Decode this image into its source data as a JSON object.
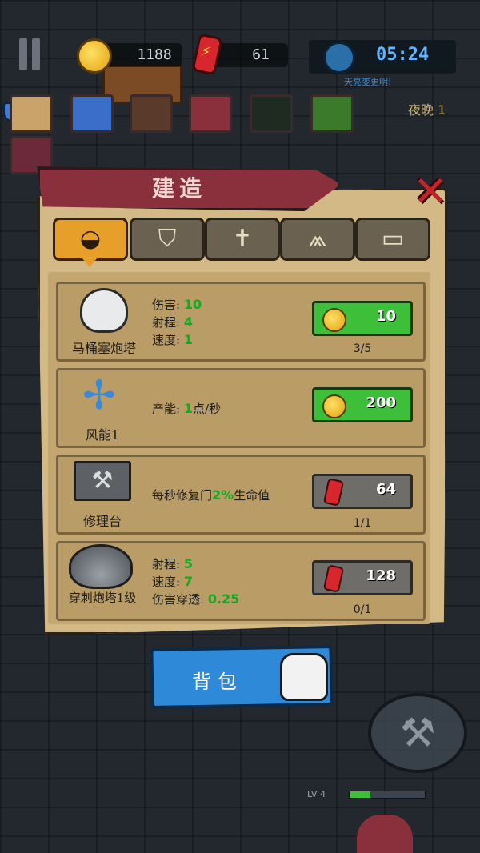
{
  "hud": {
    "coins": "1188",
    "energy": "61",
    "timer": "05:24",
    "timer_sub": "天亮变更明!",
    "night": "夜晚 1",
    "shield_level": "?"
  },
  "panel": {
    "title": "建造",
    "tabs": [
      {
        "name": "cannon",
        "glyph": "◒"
      },
      {
        "name": "shield",
        "glyph": "⛉"
      },
      {
        "name": "cross",
        "glyph": "✝"
      },
      {
        "name": "trap",
        "glyph": "⩕"
      },
      {
        "name": "scroll",
        "glyph": "▭"
      }
    ],
    "items": [
      {
        "name": "马桶塞炮塔",
        "stats": [
          {
            "label": "伤害:",
            "value": "10"
          },
          {
            "label": "射程:",
            "value": "4"
          },
          {
            "label": "速度:",
            "value": "1"
          }
        ],
        "cost": "10",
        "cost_type": "coin",
        "count": "3/5"
      },
      {
        "name": "风能1",
        "stats": [
          {
            "label": "产能:",
            "value": "1",
            "suffix": "点/秒"
          }
        ],
        "cost": "200",
        "cost_type": "coin",
        "count": ""
      },
      {
        "name": "修理台",
        "desc_pre": "每秒修复门",
        "desc_value": "2%",
        "desc_post": "生命值",
        "cost": "64",
        "cost_type": "energy",
        "count": "1/1"
      },
      {
        "name": "穿刺炮塔1级",
        "stats": [
          {
            "label": "射程:",
            "value": "5"
          },
          {
            "label": "速度:",
            "value": "7"
          },
          {
            "label": "伤害穿透:",
            "value": "0.25"
          }
        ],
        "cost": "128",
        "cost_type": "energy",
        "count": "0/1"
      }
    ]
  },
  "bag": {
    "label": "背包"
  },
  "level": {
    "label": "LV 4",
    "progress": 0.28
  },
  "colors": {
    "coin_button": "#3dbf3a",
    "energy_button": "#6f6d6a",
    "accent_green": "#16a820",
    "panel": "#d3b985"
  }
}
